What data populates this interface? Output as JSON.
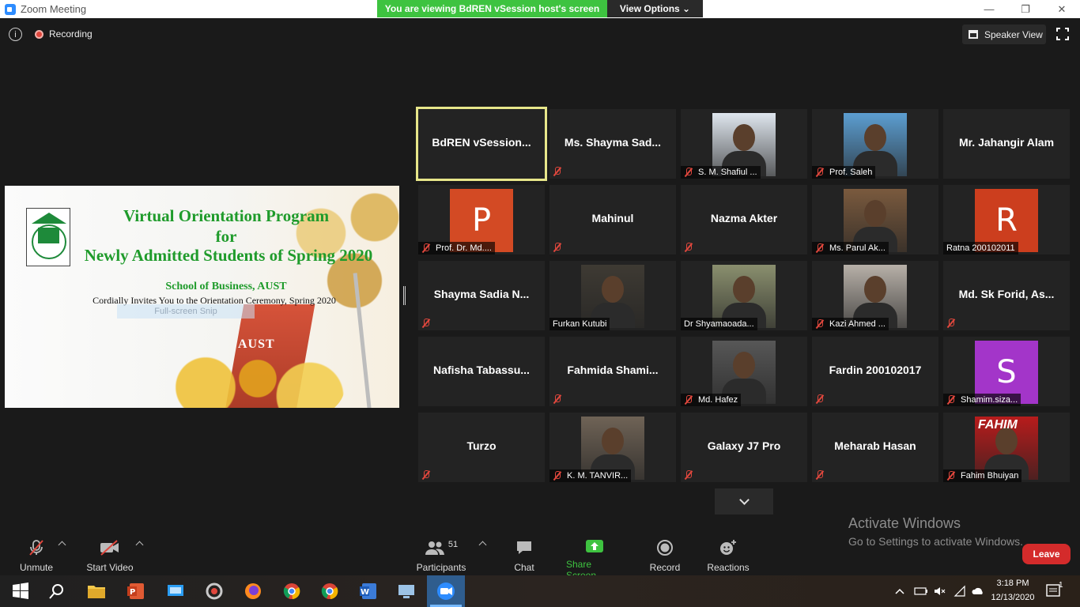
{
  "window": {
    "title": "Zoom Meeting",
    "minimize": "—",
    "restore": "❐",
    "close": "✕"
  },
  "banner": {
    "viewing": "You are viewing BdREN vSession host's screen",
    "view_options": "View Options ⌄"
  },
  "topbar": {
    "info": "i",
    "recording": "Recording",
    "speaker_view": "Speaker View"
  },
  "shared_screen": {
    "line1": "Virtual Orientation Program",
    "line2": "for",
    "line3": "Newly Admitted Students of Spring 2020",
    "line4": "School of Business, AUST",
    "line5": "Cordially Invites You to the Orientation Ceremony, Spring 2020",
    "snip_overlay": "Full-screen Snip",
    "sign": "AUST"
  },
  "participants": [
    {
      "kind": "name",
      "name": "BdREN  vSession...",
      "active": true,
      "muted": false
    },
    {
      "kind": "name",
      "name": "Ms. Shayma Sad...",
      "muted": true
    },
    {
      "kind": "photo",
      "label": "S. M. Shafiul ...",
      "muted": true,
      "tone": "#dfe6ee"
    },
    {
      "kind": "photo",
      "label": "Prof. Saleh",
      "muted": true,
      "tone": "#5c9ed1"
    },
    {
      "kind": "name",
      "name": "Mr. Jahangir Alam",
      "muted": false
    },
    {
      "kind": "letter",
      "letter": "P",
      "label": "Prof. Dr. Md....",
      "muted": true,
      "color": "#d34a24"
    },
    {
      "kind": "name",
      "name": "Mahinul",
      "muted": true
    },
    {
      "kind": "name",
      "name": "Nazma Akter",
      "muted": true
    },
    {
      "kind": "photo",
      "label": "Ms. Parul Ak...",
      "muted": true,
      "tone": "#7a5a3e"
    },
    {
      "kind": "letter",
      "letter": "R",
      "label": "Ratna 200102011",
      "muted": false,
      "color": "#cc3e1e"
    },
    {
      "kind": "name",
      "name": "Shayma Sadia N...",
      "muted": true
    },
    {
      "kind": "photo",
      "label": "Furkan Kutubi",
      "muted": false,
      "tone": "#3e3a33"
    },
    {
      "kind": "photo",
      "label": "Dr Shyamaoada...",
      "muted": false,
      "tone": "#8a8f6e"
    },
    {
      "kind": "photo",
      "label": "Kazi Ahmed ...",
      "muted": true,
      "tone": "#b7b0a8"
    },
    {
      "kind": "name",
      "name": "Md. Sk Forid, As...",
      "muted": true
    },
    {
      "kind": "name",
      "name": "Nafisha Tabassu...",
      "muted": false
    },
    {
      "kind": "name",
      "name": "Fahmida Shami...",
      "muted": true
    },
    {
      "kind": "photo",
      "label": "Md. Hafez",
      "muted": true,
      "tone": "#575757"
    },
    {
      "kind": "name",
      "name": "Fardin 200102017",
      "muted": true
    },
    {
      "kind": "letter",
      "letter": "S",
      "label": "Shamim.siza...",
      "muted": true,
      "color": "#a335c9"
    },
    {
      "kind": "name",
      "name": "Turzo",
      "muted": true
    },
    {
      "kind": "photo",
      "label": "K. M. TANVIR...",
      "muted": true,
      "tone": "#6f6356"
    },
    {
      "kind": "name",
      "name": "Galaxy J7 Pro",
      "muted": true
    },
    {
      "kind": "name",
      "name": "Meharab Hasan",
      "muted": true
    },
    {
      "kind": "photo",
      "label": "Fahim Bhuiyan",
      "muted": true,
      "tone": "#b81c1c",
      "overlay": "FAHIM"
    }
  ],
  "toolbar": {
    "unmute": "Unmute",
    "start_video": "Start Video",
    "participants": "Participants",
    "participant_count": "51",
    "chat": "Chat",
    "share_screen": "Share Screen",
    "record": "Record",
    "reactions": "Reactions",
    "leave": "Leave"
  },
  "watermark": {
    "line1": "Activate Windows",
    "line2": "Go to Settings to activate Windows."
  },
  "taskbar": {
    "time": "3:18 PM",
    "date": "12/13/2020",
    "notification_count": "1"
  },
  "colors": {
    "accent_green": "#3ec340",
    "leave_red": "#d42b2b",
    "active_border": "#e7e68a"
  }
}
